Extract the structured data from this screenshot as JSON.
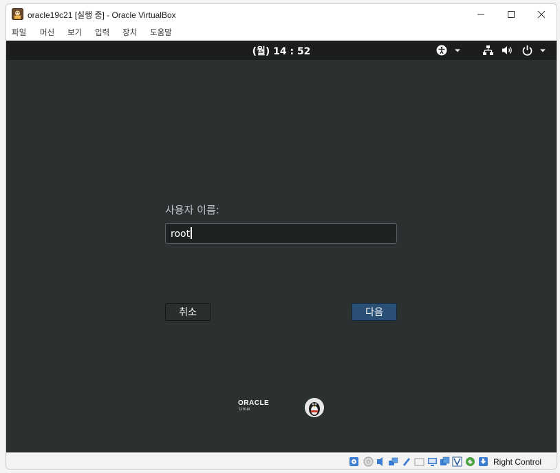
{
  "window": {
    "title": "oracle19c21 [실행 중] - Oracle VirtualBox"
  },
  "menu": {
    "items": [
      "파일",
      "머신",
      "보기",
      "입력",
      "장치",
      "도움말"
    ]
  },
  "vm": {
    "clock": "(월) 14 : 52",
    "login": {
      "label": "사용자 이름:",
      "username_value": "root",
      "cancel_label": "취소",
      "next_label": "다음"
    },
    "branding": {
      "oracle": "ORACLE",
      "linux": "Linux"
    }
  },
  "statusbar": {
    "host_key": "Right Control"
  },
  "colors": {
    "vm_background": "#2b3031",
    "topbar": "#1b1d1e",
    "next_button": "#2a5076"
  }
}
